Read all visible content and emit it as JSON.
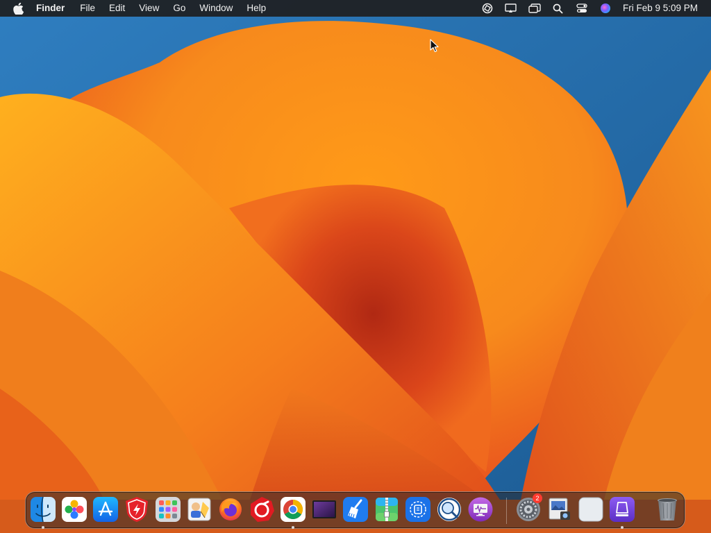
{
  "menubar": {
    "app_name": "Finder",
    "menus": [
      "File",
      "Edit",
      "View",
      "Go",
      "Window",
      "Help"
    ],
    "clock": "Fri Feb 9  5:09 PM",
    "status_icons": [
      "chatgpt-icon",
      "display-mirror-icon",
      "stage-manager-icon",
      "spotlight-search-icon",
      "control-center-icon",
      "siri-icon"
    ]
  },
  "dock": {
    "apps": [
      {
        "name": "Finder",
        "icon": "finder-icon",
        "running": true
      },
      {
        "name": "Flower App",
        "icon": "flower-app-icon",
        "running": false
      },
      {
        "name": "App Store",
        "icon": "app-store-icon",
        "running": false
      },
      {
        "name": "Security Shield",
        "icon": "shield-app-icon",
        "running": false
      },
      {
        "name": "Launchpad",
        "icon": "launchpad-icon",
        "running": false
      },
      {
        "name": "Preview Editor",
        "icon": "preview-editor-icon",
        "running": false
      },
      {
        "name": "Firefox",
        "icon": "firefox-icon",
        "running": false
      },
      {
        "name": "Red App",
        "icon": "red-circle-app-icon",
        "running": false
      },
      {
        "name": "Chrome",
        "icon": "chrome-icon",
        "running": true
      },
      {
        "name": "Screen App",
        "icon": "purple-screen-app-icon",
        "running": false
      },
      {
        "name": "Cleaner",
        "icon": "broom-cleaner-icon",
        "running": false
      },
      {
        "name": "Archive Utility",
        "icon": "archive-zip-icon",
        "running": false
      },
      {
        "name": "Screenshot Tool",
        "icon": "screenshot-tool-icon",
        "running": false
      },
      {
        "name": "Magnifier",
        "icon": "magnifier-app-icon",
        "running": false
      },
      {
        "name": "Activity Monitor",
        "icon": "activity-monitor-icon",
        "running": false
      },
      {
        "name": "System Settings",
        "icon": "system-settings-icon",
        "running": false,
        "badge": "2"
      },
      {
        "name": "Preview",
        "icon": "preview-icon",
        "running": false
      },
      {
        "name": "Blank Window",
        "icon": "blank-window-icon",
        "running": false
      },
      {
        "name": "Purple Utility",
        "icon": "purple-utility-icon",
        "running": true
      }
    ],
    "trash": {
      "name": "Trash",
      "icon": "trash-icon"
    }
  }
}
